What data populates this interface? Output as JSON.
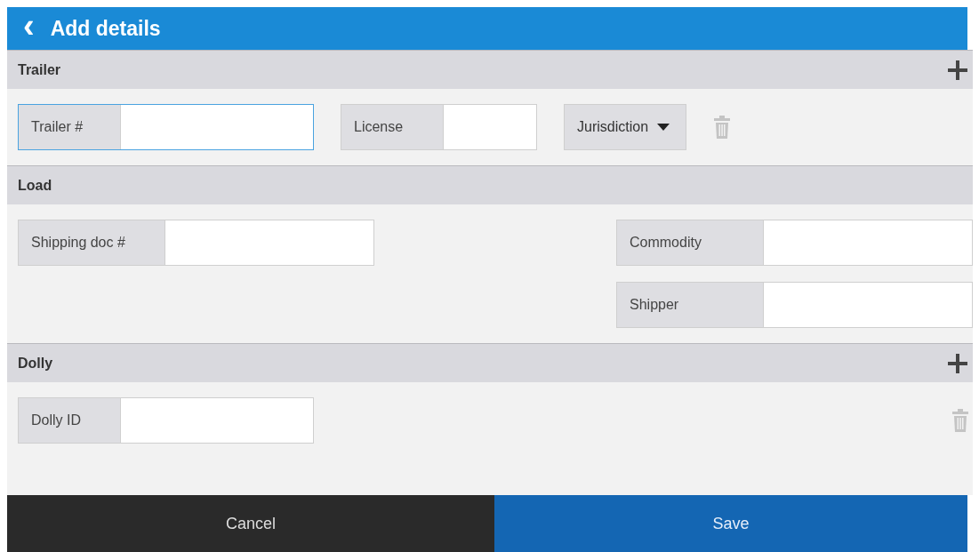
{
  "header": {
    "title": "Add details",
    "back": "‹"
  },
  "sections": [
    {
      "kind": "inline",
      "title": "Trailer",
      "columns": [
        [
          {
            "kind": "input",
            "label": "Trailer #",
            "focused": true
          },
          {
            "kind": "input",
            "label": "License",
            "focused": false
          },
          {
            "kind": "dropdown",
            "label": "Jurisdiction"
          }
        ]
      ]
    },
    {
      "kind": "split",
      "title": "Load",
      "columns": [
        [
          {
            "kind": "input",
            "label": "Shipping doc #",
            "focused": false
          }
        ],
        [
          {
            "kind": "input",
            "label": "Commodity",
            "focused": false
          },
          {
            "kind": "input",
            "label": "Shipper",
            "focused": false
          }
        ]
      ]
    },
    {
      "kind": "edge",
      "title": "Dolly",
      "columns": [
        [
          {
            "kind": "input",
            "label": "Dolly ID",
            "focused": false
          }
        ]
      ]
    }
  ],
  "footer": {
    "cancel": "Cancel",
    "save": "Save"
  }
}
